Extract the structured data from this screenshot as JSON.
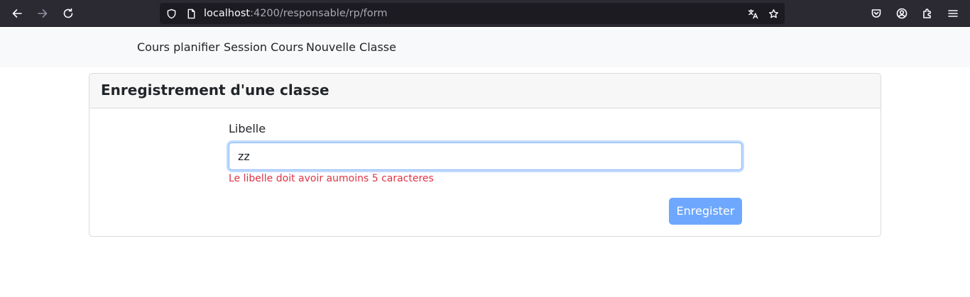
{
  "browser": {
    "url_host": "localhost",
    "url_rest": ":4200/responsable/rp/form",
    "icons": {
      "back": "back-arrow-icon",
      "forward": "forward-arrow-icon",
      "reload": "reload-icon",
      "shield": "tracking-protection-shield-icon",
      "page": "page-icon",
      "translate": "translate-icon",
      "bookmark": "bookmark-star-icon",
      "pocket": "pocket-icon",
      "account": "account-icon",
      "extensions": "extensions-icon",
      "menu": "hamburger-menu-icon"
    }
  },
  "navbar": {
    "items": [
      {
        "label": "Cours planifier"
      },
      {
        "label": "Session Cours"
      },
      {
        "label": "Nouvelle Classe"
      }
    ]
  },
  "form": {
    "title": "Enregistrement d'une classe",
    "field_label": "Libelle",
    "field_value": "zz",
    "error_message": "Le libelle doit avoir aumoins 5 caracteres",
    "submit_label": "Enregister"
  },
  "colors": {
    "accent_primary_disabled": "#6ea8fe",
    "error": "#dc3545",
    "focus_border": "#86b7fe",
    "navbar_bg": "#f8f9fa",
    "browser_chrome": "#2b2a33"
  }
}
